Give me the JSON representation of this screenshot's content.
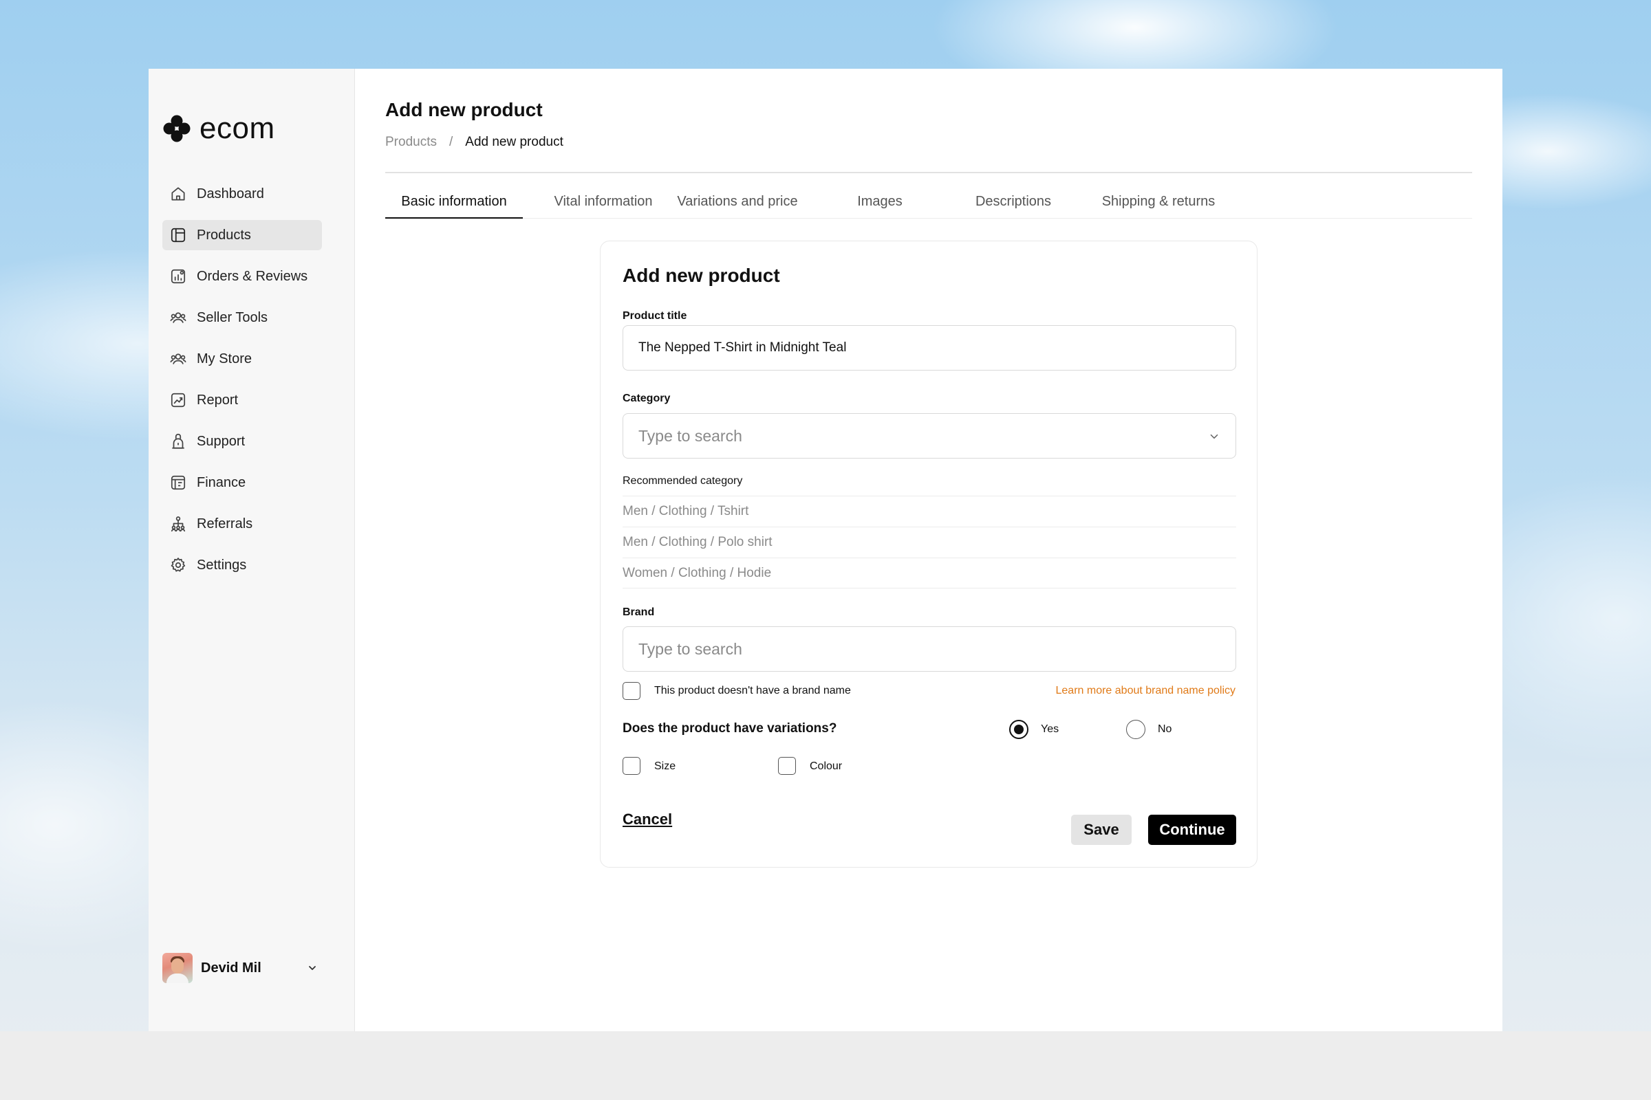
{
  "app": {
    "logo_text": "ecom"
  },
  "sidebar": {
    "items": [
      {
        "label": "Dashboard",
        "icon": "home-icon"
      },
      {
        "label": "Products",
        "icon": "product-icon",
        "active": true
      },
      {
        "label": "Orders & Reviews",
        "icon": "orders-icon"
      },
      {
        "label": "Seller Tools",
        "icon": "users-icon"
      },
      {
        "label": "My Store",
        "icon": "store-users-icon"
      },
      {
        "label": "Report",
        "icon": "report-icon"
      },
      {
        "label": "Support",
        "icon": "support-icon"
      },
      {
        "label": "Finance",
        "icon": "finance-icon"
      },
      {
        "label": "Referrals",
        "icon": "referrals-icon"
      },
      {
        "label": "Settings",
        "icon": "gear-icon"
      }
    ],
    "user": {
      "name": "Devid Mil"
    }
  },
  "header": {
    "title": "Add new product",
    "breadcrumb": {
      "parent": "Products",
      "separator": "/",
      "current": "Add new product"
    }
  },
  "tabs": [
    {
      "label": "Basic information",
      "active": true
    },
    {
      "label": "Vital information"
    },
    {
      "label": "Variations and price"
    },
    {
      "label": "Images"
    },
    {
      "label": "Descriptions"
    },
    {
      "label": "Shipping & returns"
    }
  ],
  "form": {
    "title": "Add new product",
    "product_title": {
      "label": "Product title",
      "value": "The Nepped T-Shirt in Midnight Teal"
    },
    "category": {
      "label": "Category",
      "placeholder": "Type to search"
    },
    "recommended": {
      "label": "Recommended category",
      "items": [
        "Men / Clothing / Tshirt",
        "Men / Clothing / Polo shirt",
        "Women / Clothing / Hodie"
      ]
    },
    "brand": {
      "label": "Brand",
      "placeholder": "Type to search",
      "no_brand_label": "This product doesn't have a brand name",
      "no_brand_checked": false,
      "policy_link": "Learn more about brand name policy"
    },
    "variations": {
      "question": "Does the product have variations?",
      "yes_label": "Yes",
      "no_label": "No",
      "selected": "Yes",
      "options": [
        {
          "label": "Size",
          "checked": false
        },
        {
          "label": "Colour",
          "checked": false
        }
      ]
    },
    "actions": {
      "cancel": "Cancel",
      "save": "Save",
      "continue": "Continue"
    }
  },
  "colors": {
    "accent_link": "#e07a18",
    "primary_button": "#000000",
    "secondary_button": "#e4e4e4",
    "active_nav": "#e6e6e6"
  }
}
